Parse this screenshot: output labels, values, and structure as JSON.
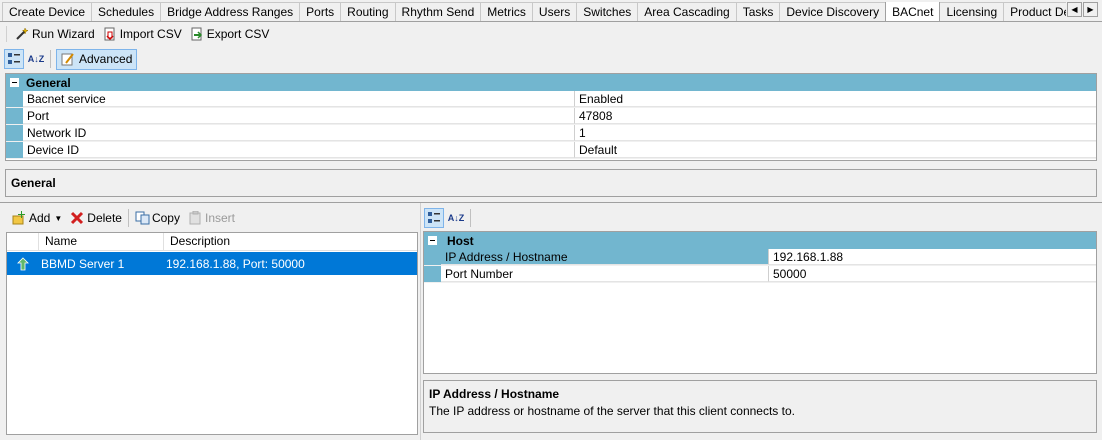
{
  "tabs": [
    {
      "label": "Create Device",
      "active": false
    },
    {
      "label": "Schedules",
      "active": false
    },
    {
      "label": "Bridge Address Ranges",
      "active": false
    },
    {
      "label": "Ports",
      "active": false
    },
    {
      "label": "Routing",
      "active": false
    },
    {
      "label": "Rhythm Send",
      "active": false
    },
    {
      "label": "Metrics",
      "active": false
    },
    {
      "label": "Users",
      "active": false
    },
    {
      "label": "Switches",
      "active": false
    },
    {
      "label": "Area Cascading",
      "active": false
    },
    {
      "label": "Tasks",
      "active": false
    },
    {
      "label": "Device Discovery",
      "active": false
    },
    {
      "label": "BACnet",
      "active": true
    },
    {
      "label": "Licensing",
      "active": false
    },
    {
      "label": "Product Details",
      "active": false
    }
  ],
  "tab_scroll": {
    "left": "◀",
    "right": "▶"
  },
  "toolbar": {
    "run_wizard": "Run Wizard",
    "import_csv": "Import CSV",
    "export_csv": "Export CSV"
  },
  "property_grid": {
    "sort_az": "A↓Z",
    "advanced_label": "Advanced",
    "category": "General",
    "rows": [
      {
        "name": "Bacnet service",
        "value": "Enabled"
      },
      {
        "name": "Port",
        "value": "47808"
      },
      {
        "name": "Network ID",
        "value": "1"
      },
      {
        "name": "Device ID",
        "value": "Default"
      }
    ],
    "description_title": "General"
  },
  "bbmd_toolbar": {
    "add": "Add",
    "delete": "Delete",
    "copy": "Copy",
    "insert": "Insert"
  },
  "bbmd_list": {
    "columns": [
      "Name",
      "Description"
    ],
    "rows": [
      {
        "name": "BBMD Server 1",
        "description": "192.168.1.88, Port: 50000",
        "selected": true
      }
    ]
  },
  "host_grid": {
    "category": "Host",
    "rows": [
      {
        "name": "IP Address / Hostname",
        "value": "192.168.1.88"
      },
      {
        "name": "Port Number",
        "value": "50000"
      }
    ],
    "description_title": "IP Address / Hostname",
    "description_text": "The IP address or hostname of the server that this client connects to."
  },
  "colors": {
    "category_bg": "#72b6cf",
    "selection": "#0078d7",
    "panel_bg": "#f0f0f0"
  }
}
